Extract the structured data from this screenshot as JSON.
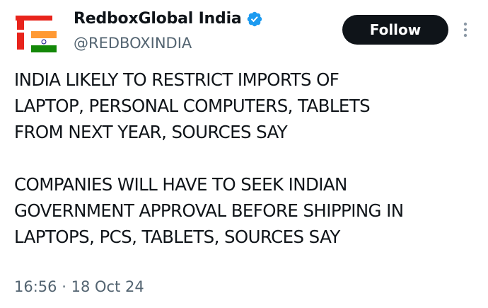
{
  "account": {
    "display_name": "RedboxGlobal India",
    "handle": "@REDBOXINDIA",
    "verified": true,
    "verified_icon": "verified-badge-icon",
    "avatar_icon": "redbox-india-flag-logo"
  },
  "actions": {
    "follow_label": "Follow",
    "more_icon": "more-vertical-icon"
  },
  "tweet": {
    "paragraph1": [
      "INDIA LIKELY TO RESTRICT IMPORTS OF",
      "LAPTOP, PERSONAL COMPUTERS, TABLETS",
      "FROM NEXT YEAR, SOURCES SAY"
    ],
    "paragraph2": [
      "COMPANIES WILL HAVE TO SEEK INDIAN",
      "GOVERNMENT APPROVAL BEFORE SHIPPING IN",
      "LAPTOPS, PCS, TABLETS, SOURCES SAY"
    ],
    "time": "16:56",
    "separator": "·",
    "date": "18 Oct 24"
  },
  "colors": {
    "text_primary": "#0f1419",
    "text_secondary": "#536471",
    "verified_blue": "#1d9bf0",
    "brand_red": "#e8241c",
    "flag_saffron": "#ff9933",
    "flag_green": "#138808",
    "flag_chakra": "#000080"
  }
}
